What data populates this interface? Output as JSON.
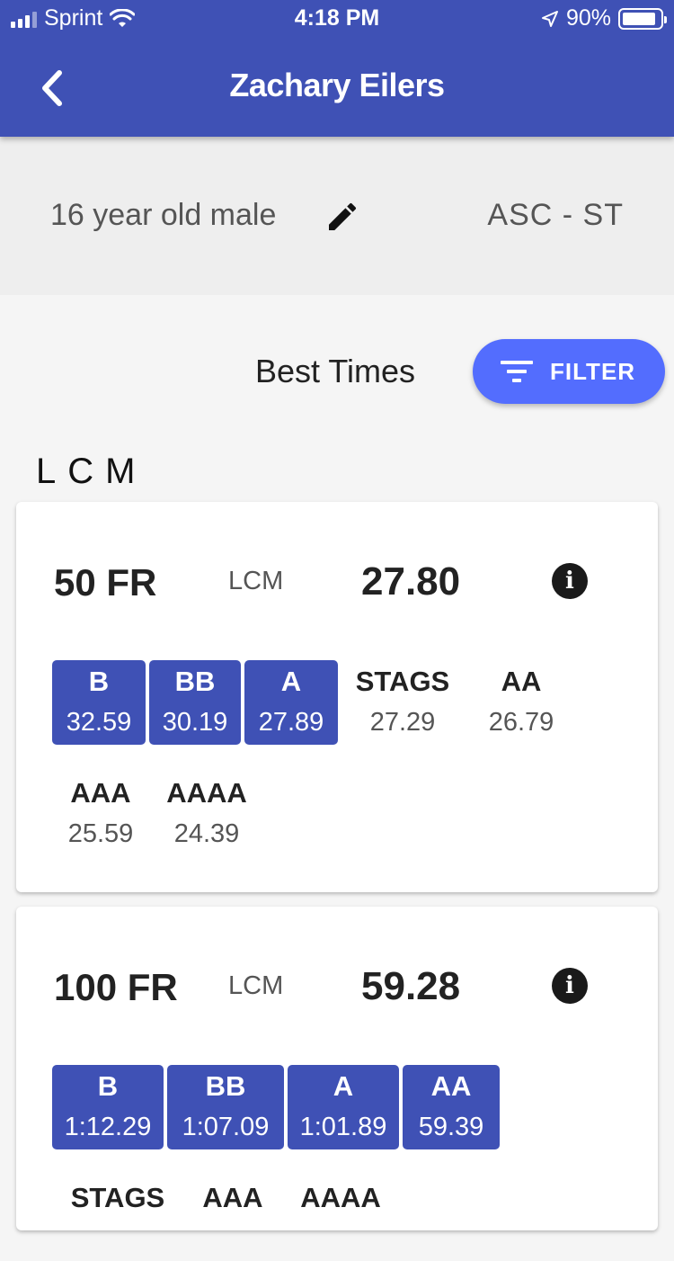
{
  "status_bar": {
    "carrier": "Sprint",
    "time": "4:18 PM",
    "battery": "90%",
    "battery_level": 0.9
  },
  "header": {
    "title": "Zachary Eilers"
  },
  "profile": {
    "description": "16 year old male",
    "team": "ASC - ST"
  },
  "best_times": {
    "title": "Best Times",
    "filter_label": "FILTER",
    "course_group": "LCM"
  },
  "events": [
    {
      "name": "50 FR",
      "course": "LCM",
      "time": "27.80",
      "standards": [
        {
          "level": "B",
          "time": "32.59",
          "achieved": true
        },
        {
          "level": "BB",
          "time": "30.19",
          "achieved": true
        },
        {
          "level": "A",
          "time": "27.89",
          "achieved": true
        },
        {
          "level": "STAGS",
          "time": "27.29",
          "achieved": false
        },
        {
          "level": "AA",
          "time": "26.79",
          "achieved": false
        },
        {
          "level": "AAA",
          "time": "25.59",
          "achieved": false
        },
        {
          "level": "AAAA",
          "time": "24.39",
          "achieved": false
        }
      ]
    },
    {
      "name": "100 FR",
      "course": "LCM",
      "time": "59.28",
      "standards": [
        {
          "level": "B",
          "time": "1:12.29",
          "achieved": true
        },
        {
          "level": "BB",
          "time": "1:07.09",
          "achieved": true
        },
        {
          "level": "A",
          "time": "1:01.89",
          "achieved": true
        },
        {
          "level": "AA",
          "time": "59.39",
          "achieved": true
        },
        {
          "level": "STAGS",
          "time": "",
          "achieved": false
        },
        {
          "level": "AAA",
          "time": "",
          "achieved": false
        },
        {
          "level": "AAAA",
          "time": "",
          "achieved": false
        }
      ]
    }
  ],
  "colors": {
    "primary": "#3f51b5",
    "accent": "#536dfe",
    "background": "#f5f5f5"
  }
}
